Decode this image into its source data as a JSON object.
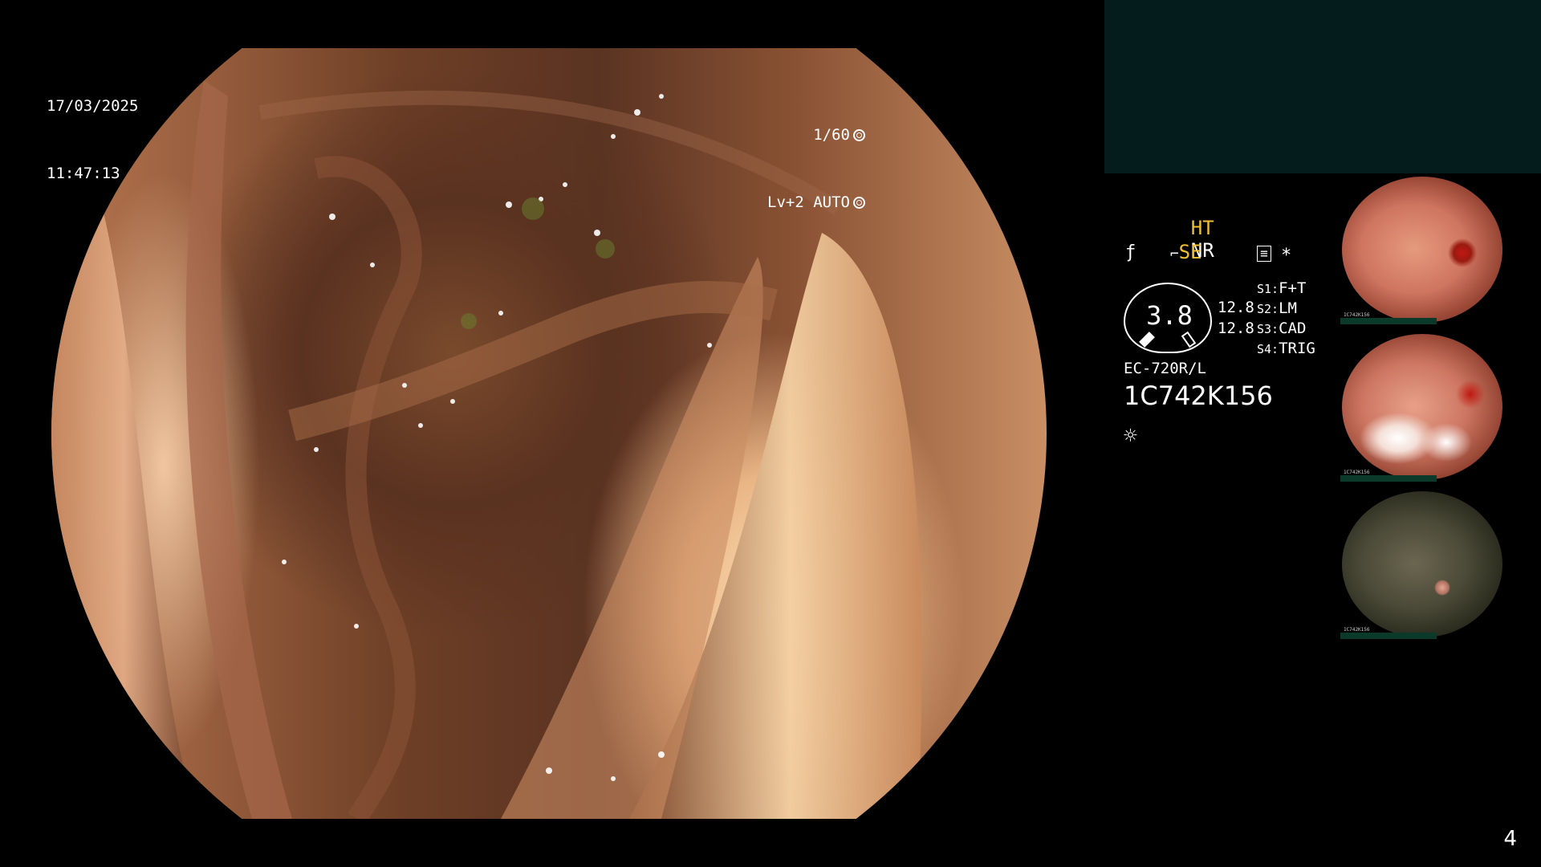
{
  "overlay": {
    "date": "17/03/2025",
    "time": "11:47:13",
    "shutter": "1/60",
    "level": "Lv+2 AUTO",
    "shutter_icon": "aperture-icon",
    "auto_icon": "target-icon"
  },
  "settings": {
    "ht": "HT",
    "nr": "NR",
    "se": "SE",
    "enhance_icon": "enhance-icon",
    "freeze_icon": "freeze-icon",
    "memo_icon": "memo-icon",
    "asterisk": "*",
    "gauge_value": "3.8",
    "num_upper": "12.8",
    "num_lower": "12.8",
    "switches": [
      {
        "key": "S1:",
        "value": "F+T"
      },
      {
        "key": "S2:",
        "value": "LM"
      },
      {
        "key": "S3:",
        "value": "CAD"
      },
      {
        "key": "S4:",
        "value": "TRIG"
      }
    ],
    "scope_model": "EC-720R/L",
    "serial": "1C742K156",
    "light_icon": "light-icon"
  },
  "thumbnails": [
    {
      "name": "thumbnail-1",
      "label": "1C742K156"
    },
    {
      "name": "thumbnail-2",
      "label": "1C742K156"
    },
    {
      "name": "thumbnail-3",
      "label": "1C742K156"
    }
  ],
  "page_number": "4",
  "colors": {
    "background": "#000000",
    "accent_yellow": "#f0c030",
    "info_block": "#041c1c"
  }
}
